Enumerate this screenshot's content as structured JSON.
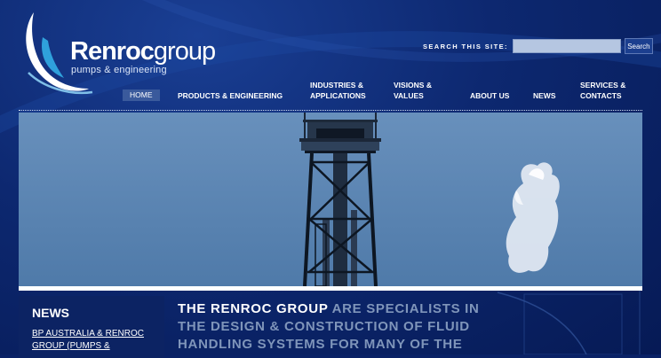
{
  "brand": {
    "name_bold": "Renroc",
    "name_light": "group",
    "tagline": "pumps & engineering"
  },
  "search": {
    "label": "SEARCH THIS SITE:",
    "placeholder": "",
    "button_label": "Search"
  },
  "nav": {
    "items": [
      {
        "label": "HOME",
        "active": true
      },
      {
        "label": "PRODUCTS & ENGINEERING"
      },
      {
        "line1": "INDUSTRIES &",
        "line2": "APPLICATIONS"
      },
      {
        "line1": "VISIONS &",
        "line2": "VALUES"
      },
      {
        "label": "ABOUT US"
      },
      {
        "label": "NEWS"
      },
      {
        "line1": "SERVICES &",
        "line2": "CONTACTS"
      }
    ]
  },
  "news": {
    "heading": "NEWS",
    "link_line1": "BP AUSTRALIA & RENROC",
    "link_line2": "GROUP (PUMPS &"
  },
  "intro": {
    "highlight": "THE RENROC GROUP",
    "line1_rest": " ARE SPECIALISTS IN",
    "line2": "THE DESIGN & CONSTRUCTION OF FLUID",
    "line3": "HANDLING SYSTEMS FOR MANY OF THE"
  },
  "colors": {
    "background": "#0a2266",
    "hero_sky": "#5d86b3",
    "nav_active": "#3a5a9c",
    "intro_muted": "#7f95ba"
  }
}
